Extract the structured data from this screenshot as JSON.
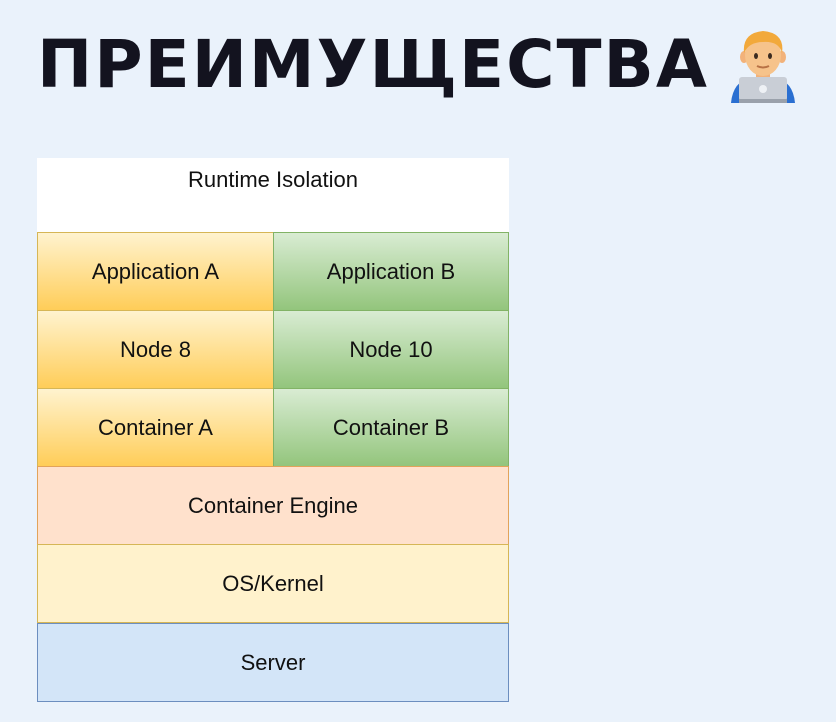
{
  "page": {
    "title": "ПРЕИМУЩЕСТВА",
    "title_icon": "technologist-emoji-icon"
  },
  "diagram": {
    "caption": "Runtime Isolation",
    "columns": [
      {
        "app": "Application A",
        "runtime": "Node 8",
        "container": "Container A",
        "color": "#ffcd58"
      },
      {
        "app": "Application B",
        "runtime": "Node 10",
        "container": "Container B",
        "color": "#93c57c"
      }
    ],
    "layers": {
      "engine": "Container Engine",
      "os": "OS/Kernel",
      "server": "Server"
    },
    "colors": {
      "engine": "#ffe1cc",
      "os": "#fff2cc",
      "server": "#d3e5f8"
    }
  }
}
